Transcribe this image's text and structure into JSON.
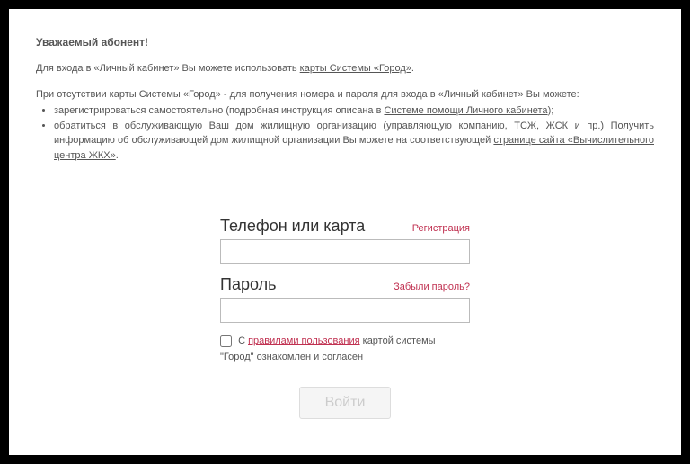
{
  "header": {
    "title": "Уважаемый абонент!"
  },
  "info": {
    "line1_pre": "Для входа в «Личный кабинет» Вы можете использовать ",
    "line1_link": "карты Системы «Город»",
    "line1_post": ".",
    "line2": "При отсутствии карты Системы «Город» - для получения номера и пароля для входа в «Личный кабинет» Вы можете:",
    "bullet1_pre": "зарегистрироваться самостоятельно (подробная инструкция описана в ",
    "bullet1_link": "Системе помощи Личного кабинета",
    "bullet1_post": ");",
    "bullet2_pre": "обратиться в обслуживающую Ваш дом жилищную организацию (управляющую компанию, ТСЖ, ЖСК и пр.) Получить информацию об обслуживающей дом жилищной организации Вы можете на соответствующей ",
    "bullet2_link": "странице сайта «Вычислительного центра ЖКХ»",
    "bullet2_post": "."
  },
  "form": {
    "phone_label": "Телефон или карта",
    "register_link": "Регистрация",
    "password_label": "Пароль",
    "forgot_link": "Забыли пароль?",
    "agree_pre": "С ",
    "agree_link": "правилами пользования",
    "agree_post": " картой системы \"Город\" ознакомлен и согласен",
    "login_button": "Войти"
  }
}
